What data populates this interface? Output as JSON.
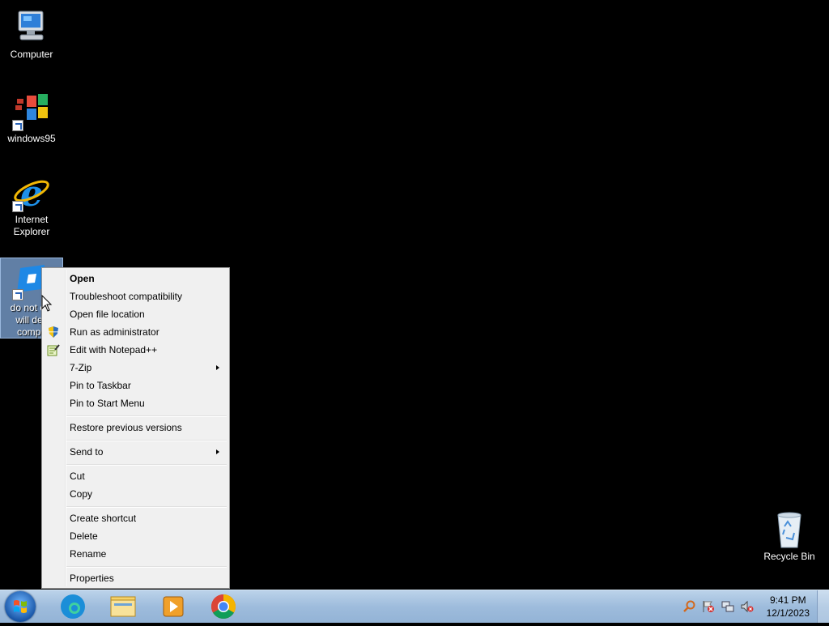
{
  "desktop": {
    "icons": [
      {
        "label": "Computer",
        "icon": "computer-icon"
      },
      {
        "label": "windows95",
        "icon": "windows95-icon"
      },
      {
        "label": "Internet Explorer",
        "icon": "internet-explorer-icon"
      },
      {
        "label": "do not o it will des compu",
        "icon": "app-shortcut-icon"
      },
      {
        "label": "Recycle Bin",
        "icon": "recycle-bin-icon"
      }
    ]
  },
  "context_menu": {
    "items": [
      {
        "label": "Open",
        "bold": true
      },
      {
        "label": "Troubleshoot compatibility"
      },
      {
        "label": "Open file location"
      },
      {
        "label": "Run as administrator",
        "icon": "uac-shield-icon"
      },
      {
        "label": "Edit with Notepad++",
        "icon": "notepadpp-icon"
      },
      {
        "label": "7-Zip",
        "submenu": true
      },
      {
        "label": "Pin to Taskbar"
      },
      {
        "label": "Pin to Start Menu"
      },
      {
        "label": "Restore previous versions"
      },
      {
        "label": "Send to",
        "submenu": true
      },
      {
        "label": "Cut"
      },
      {
        "label": "Copy"
      },
      {
        "label": "Create shortcut"
      },
      {
        "label": "Delete"
      },
      {
        "label": "Rename"
      },
      {
        "label": "Properties"
      }
    ]
  },
  "taskbar": {
    "pinned": [
      "edge-icon",
      "file-explorer-icon",
      "media-player-icon",
      "chrome-icon"
    ],
    "tray": [
      "search-tray-icon",
      "action-center-flag-icon",
      "network-icon",
      "volume-muted-icon"
    ],
    "clock": {
      "time": "9:41 PM",
      "date": "12/1/2023"
    }
  },
  "colors": {
    "desktop": "#000000",
    "selection": "#82aadc",
    "taskbar": "#a9c4e2"
  }
}
